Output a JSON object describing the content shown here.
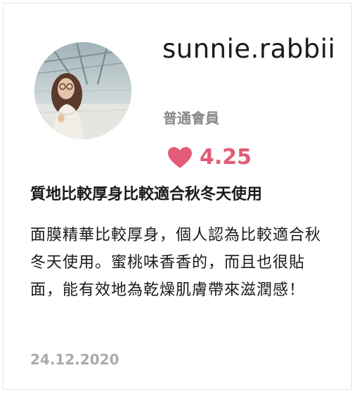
{
  "review": {
    "username": "sunnie.rabbii",
    "member_level": "普通會員",
    "rating": "4.25",
    "title": "質地比較厚身比較適合秋冬天使用",
    "body": "面膜精華比較厚身，個人認為比較適合秋冬天使用。蜜桃味香香的，而且也很貼面，能有效地為乾燥肌膚帶來滋潤感！",
    "date": "24.12.2020"
  },
  "icons": {
    "rating": "heart-icon"
  },
  "colors": {
    "heart": "#e25c78",
    "muted_text": "#888888",
    "date_text": "#aaaaaa"
  }
}
